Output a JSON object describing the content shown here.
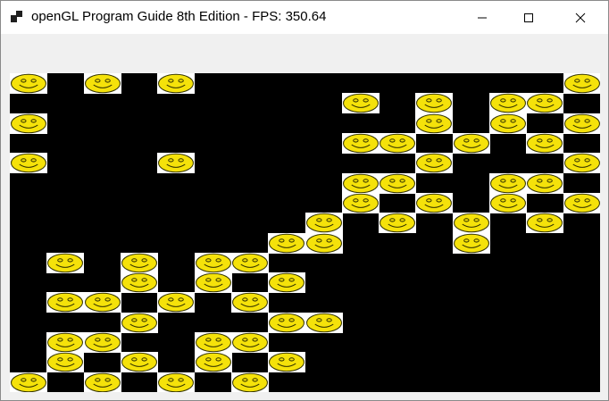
{
  "window": {
    "title": "openGL Program Guide 8th Edition - FPS: 350.64",
    "app_icon": "opengl-app-icon",
    "controls": {
      "minimize_icon": "minimize-icon",
      "maximize_icon": "maximize-icon",
      "close_icon": "close-icon"
    }
  },
  "viewport": {
    "background": "#000000",
    "grid": {
      "cols": 16,
      "rows": 16
    },
    "tile": {
      "icon": "smiley-face-icon",
      "face_color": "#f5e20a",
      "outline_color": "#333300",
      "background": "#ffffff"
    },
    "cells": [
      [
        0,
        0
      ],
      [
        2,
        0
      ],
      [
        4,
        0
      ],
      [
        15,
        0
      ],
      [
        9,
        1
      ],
      [
        11,
        1
      ],
      [
        13,
        1
      ],
      [
        14,
        1
      ],
      [
        0,
        2
      ],
      [
        11,
        2
      ],
      [
        13,
        2
      ],
      [
        15,
        2
      ],
      [
        9,
        3
      ],
      [
        10,
        3
      ],
      [
        12,
        3
      ],
      [
        14,
        3
      ],
      [
        0,
        4
      ],
      [
        4,
        4
      ],
      [
        11,
        4
      ],
      [
        15,
        4
      ],
      [
        9,
        5
      ],
      [
        10,
        5
      ],
      [
        13,
        5
      ],
      [
        14,
        5
      ],
      [
        9,
        6
      ],
      [
        11,
        6
      ],
      [
        13,
        6
      ],
      [
        15,
        6
      ],
      [
        8,
        7
      ],
      [
        10,
        7
      ],
      [
        12,
        7
      ],
      [
        14,
        7
      ],
      [
        7,
        8
      ],
      [
        8,
        8
      ],
      [
        12,
        8
      ],
      [
        1,
        9
      ],
      [
        3,
        9
      ],
      [
        5,
        9
      ],
      [
        6,
        9
      ],
      [
        3,
        10
      ],
      [
        5,
        10
      ],
      [
        7,
        10
      ],
      [
        1,
        11
      ],
      [
        2,
        11
      ],
      [
        4,
        11
      ],
      [
        6,
        11
      ],
      [
        3,
        12
      ],
      [
        7,
        12
      ],
      [
        8,
        12
      ],
      [
        1,
        13
      ],
      [
        2,
        13
      ],
      [
        5,
        13
      ],
      [
        6,
        13
      ],
      [
        1,
        14
      ],
      [
        3,
        14
      ],
      [
        5,
        14
      ],
      [
        7,
        14
      ],
      [
        0,
        15
      ],
      [
        2,
        15
      ],
      [
        4,
        15
      ],
      [
        6,
        15
      ]
    ]
  }
}
